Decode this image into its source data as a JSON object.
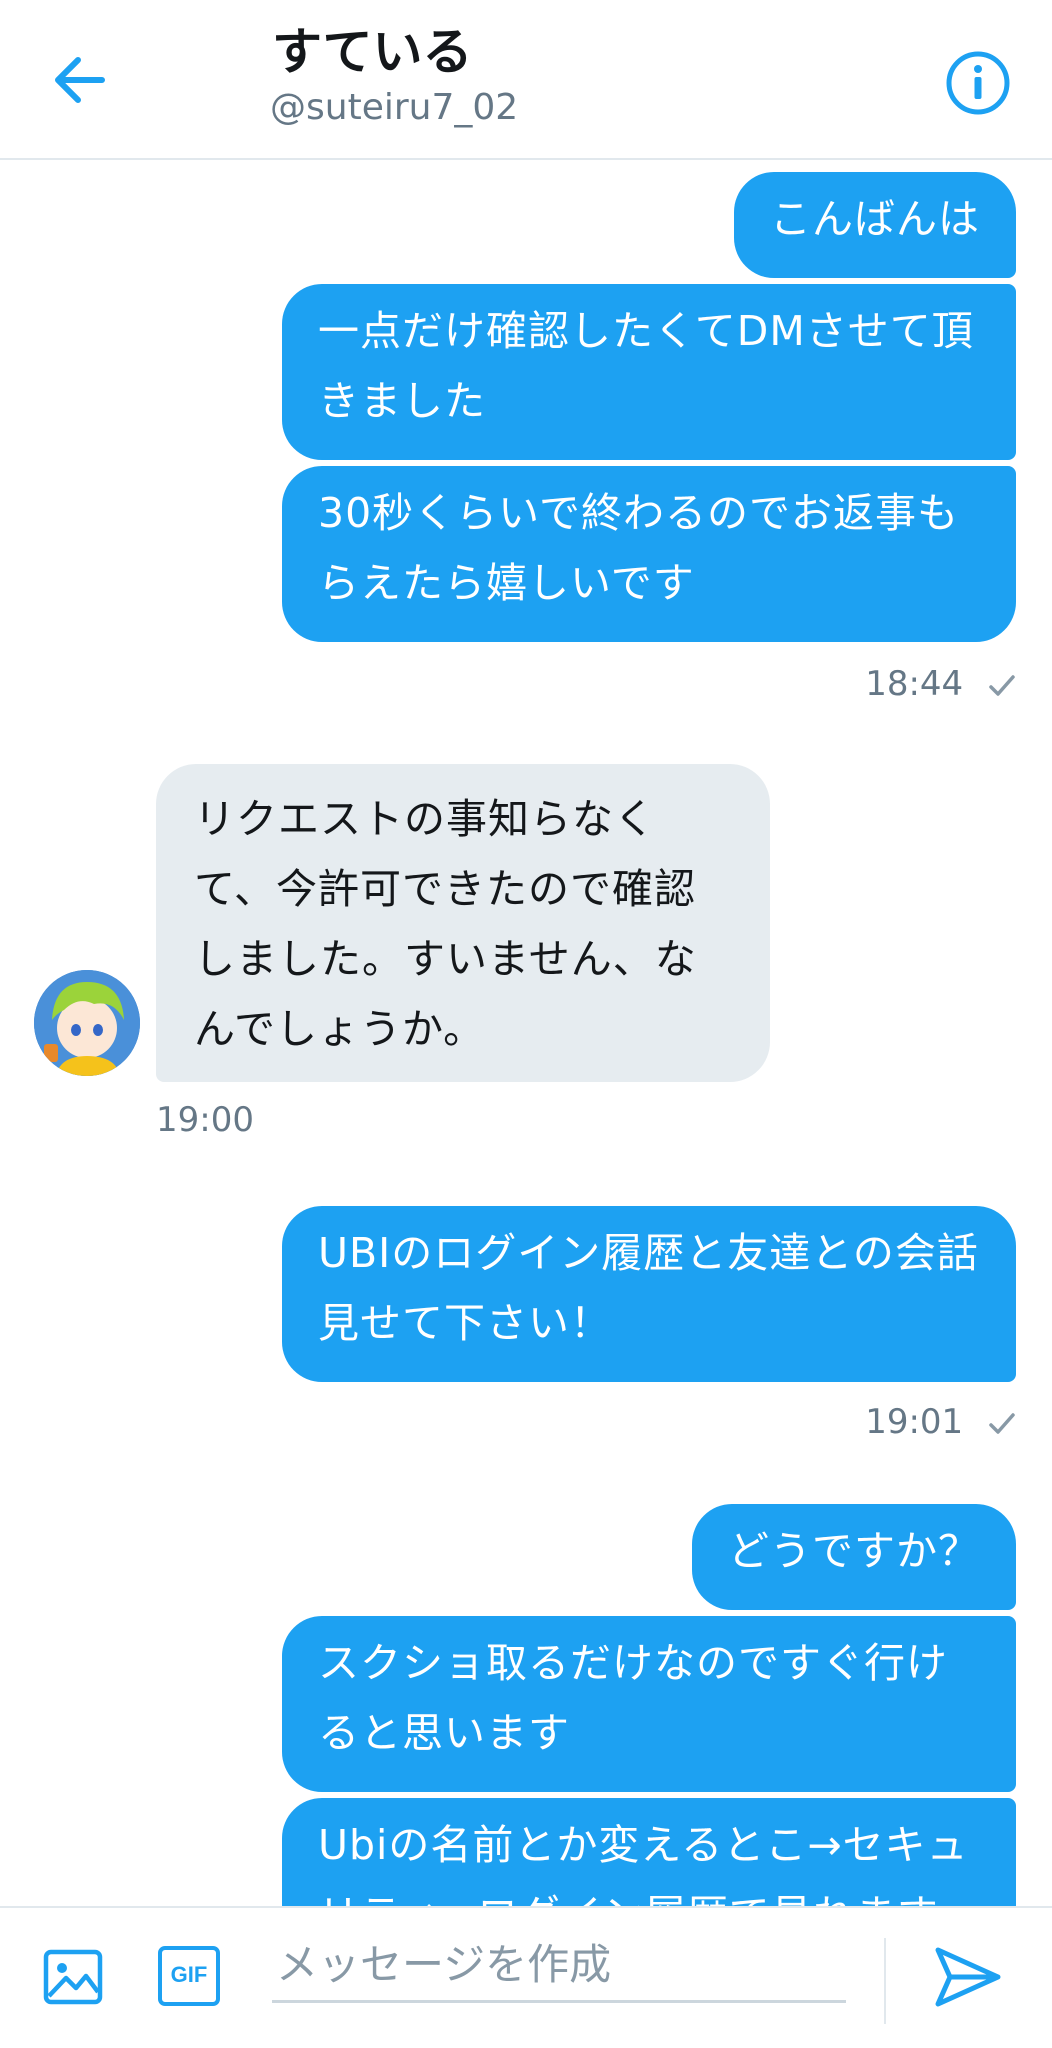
{
  "header": {
    "title": "すている",
    "handle": "@suteiru7_02"
  },
  "messages": [
    {
      "text": "こんばんは"
    },
    {
      "text": "一点だけ確認したくてDMさせて頂きました"
    },
    {
      "text": "30秒くらいで終わるのでお返事もらえたら嬉しいです"
    },
    {
      "time": "18:44"
    },
    {
      "text": "リクエストの事知らなくて、今許可できたので確認しました。すいません、なんでしょうか。"
    },
    {
      "time": "19:00"
    },
    {
      "text": "UBIのログイン履歴と友達との会話見せて下さい！"
    },
    {
      "time": "19:01"
    },
    {
      "text": "どうですか？"
    },
    {
      "text": "スクショ取るだけなのですぐ行けると思います"
    },
    {
      "text": "Ubiの名前とか変えるとこ→セキュリティ→ログイン履歴で見れます"
    }
  ],
  "composer": {
    "placeholder": "メッセージを作成",
    "gif_label": "GIF"
  },
  "colors": {
    "accent": "#1da1f2",
    "incoming_bubble": "#e6ecf0"
  },
  "icons": [
    "back-arrow-icon",
    "info-icon",
    "check-icon",
    "image-icon",
    "gif-icon",
    "send-icon"
  ]
}
